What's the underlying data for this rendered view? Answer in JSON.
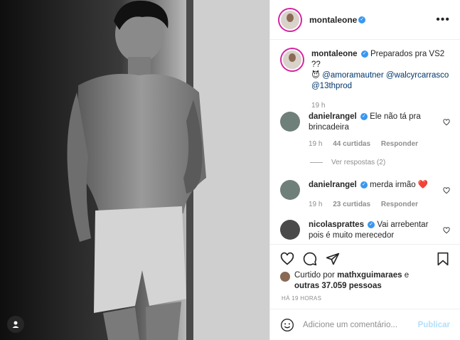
{
  "post": {
    "username": "montaleone",
    "more_label": "•••",
    "caption_text": "Preparados pra VS2 ??",
    "caption_emoji": "😈",
    "mentions": [
      "@amoramautner",
      "@walcyrcarrasco",
      "@13thprod"
    ],
    "caption_time": "19 h"
  },
  "comments": [
    {
      "username": "danielrangel",
      "text_line1": "Ele não tá pra",
      "text_line2": "brincadeira",
      "time": "19 h",
      "likes": "44 curtidas",
      "reply": "Responder",
      "view_replies": "Ver respostas (2)"
    },
    {
      "username": "danielrangel",
      "text": "merda irmão",
      "emoji": "❤️",
      "time": "19 h",
      "likes": "23 curtidas",
      "reply": "Responder"
    },
    {
      "username": "nicolasprattes",
      "text_line1": "Vai arrebentar",
      "text_line2": "pois é muito merecedor"
    }
  ],
  "likes": {
    "prefix": "Curtido por",
    "user": "mathxguimaraes",
    "connector": "e",
    "others": "outras 37.059 pessoas"
  },
  "timestamp": "HÁ 19 HORAS",
  "comment_box": {
    "placeholder": "Adicione um comentário...",
    "post_label": "Publicar"
  },
  "colors": {
    "accent": "#3897f0",
    "publish_disabled": "#b2dffc",
    "heart_red": "#ed4956"
  }
}
